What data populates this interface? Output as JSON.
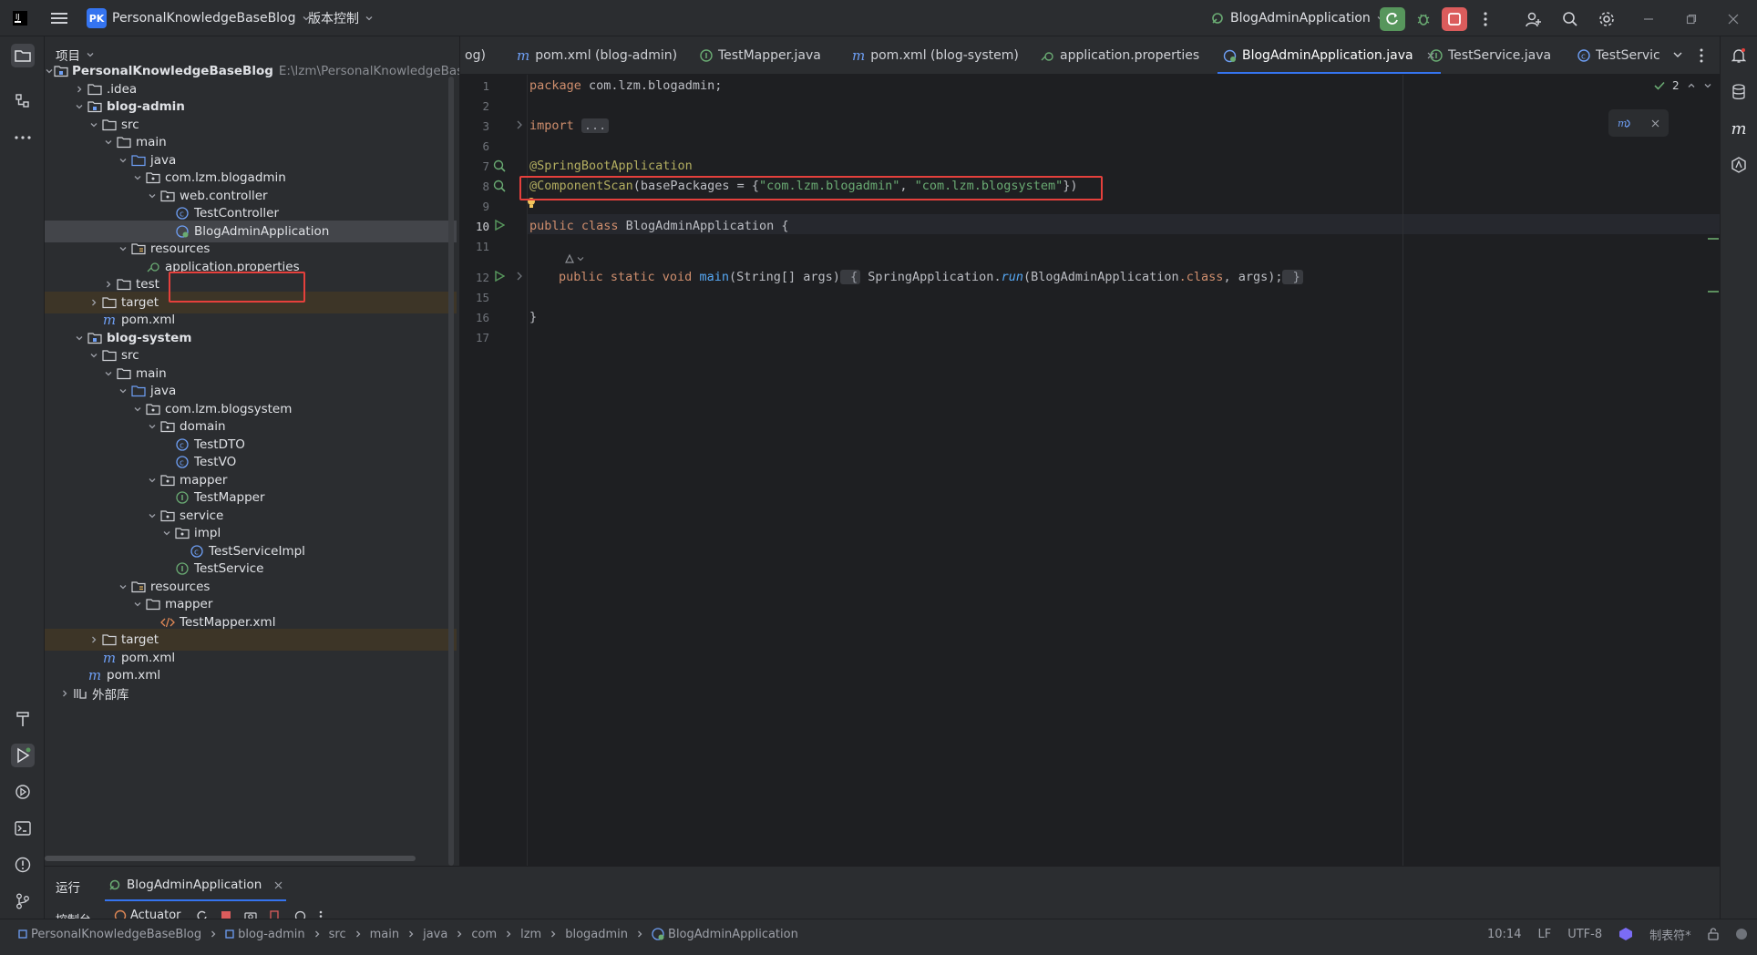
{
  "titlebar": {
    "project_badge": "PK",
    "project_name": "PersonalKnowledgeBaseBlog",
    "vcs_menu": "版本控制",
    "run_config": "BlogAdminApplication"
  },
  "project_panel": {
    "header": "项目",
    "root_name": "PersonalKnowledgeBaseBlog",
    "root_path": "E:\\lzm\\PersonalKnowledgeBaseBlog",
    "items": [
      {
        "label": ".idea"
      },
      {
        "label": "blog-admin"
      },
      {
        "label": "src"
      },
      {
        "label": "main"
      },
      {
        "label": "java"
      },
      {
        "label": "com.lzm.blogadmin"
      },
      {
        "label": "web.controller"
      },
      {
        "label": "TestController"
      },
      {
        "label": "BlogAdminApplication"
      },
      {
        "label": "resources"
      },
      {
        "label": "application.properties"
      },
      {
        "label": "test"
      },
      {
        "label": "target"
      },
      {
        "label": "pom.xml"
      },
      {
        "label": "blog-system"
      },
      {
        "label": "src"
      },
      {
        "label": "main"
      },
      {
        "label": "java"
      },
      {
        "label": "com.lzm.blogsystem"
      },
      {
        "label": "domain"
      },
      {
        "label": "TestDTO"
      },
      {
        "label": "TestVO"
      },
      {
        "label": "mapper"
      },
      {
        "label": "TestMapper"
      },
      {
        "label": "service"
      },
      {
        "label": "impl"
      },
      {
        "label": "TestServiceImpl"
      },
      {
        "label": "TestService"
      },
      {
        "label": "resources"
      },
      {
        "label": "mapper"
      },
      {
        "label": "TestMapper.xml"
      },
      {
        "label": "target"
      },
      {
        "label": "pom.xml"
      },
      {
        "label": "pom.xml"
      },
      {
        "label": "外部库"
      }
    ]
  },
  "tabs": [
    {
      "label": "og)"
    },
    {
      "label": "pom.xml (blog-admin)"
    },
    {
      "label": "TestMapper.java"
    },
    {
      "label": "pom.xml (blog-system)"
    },
    {
      "label": "application.properties"
    },
    {
      "label": "BlogAdminApplication.java"
    },
    {
      "label": "TestService.java"
    },
    {
      "label": "TestServic"
    }
  ],
  "editor": {
    "line_numbers": [
      "1",
      "2",
      "3",
      "6",
      "7",
      "8",
      "9",
      "10",
      "11",
      "12",
      "15",
      "16",
      "17"
    ],
    "l1_kw": "package",
    "l1_rest": " com.lzm.blogadmin;",
    "l3_kw": "import",
    "l3_fold": "...",
    "l7_ann": "@SpringBootApplication",
    "l8_ann": "@ComponentScan",
    "l8_mid": "(basePackages = {",
    "l8_str1": "\"com.lzm.blogadmin\"",
    "l8_comma": ", ",
    "l8_str2": "\"com.lzm.blogsystem\"",
    "l8_end": "})",
    "l10_kw": "public class",
    "l10_cls": " BlogAdminApplication",
    "l10_end": " {",
    "l12_kw": "public static void",
    "l12_fn": " main",
    "l12_args": "(String[] args)",
    "l12_open": " {",
    "l12_body1": " SpringApplication.",
    "l12_run": "run",
    "l12_body2": "(BlogAdminApplication",
    "l12_class": ".class",
    "l12_body3": ", args);",
    "l12_close": " }",
    "l16_brace": "}",
    "inspection_count": "2"
  },
  "bottom_panel": {
    "tab_run": "运行",
    "tab_app": "BlogAdminApplication",
    "sub_console": "控制台",
    "sub_actuator": "Actuator"
  },
  "statusbar": {
    "breadcrumbs": [
      "PersonalKnowledgeBaseBlog",
      "blog-admin",
      "src",
      "main",
      "java",
      "com",
      "lzm",
      "blogadmin",
      "BlogAdminApplication"
    ],
    "position": "10:14",
    "line_sep": "LF",
    "encoding": "UTF-8",
    "indent": "制表符*"
  },
  "colors": {
    "accent": "#3574f0",
    "highlight_box": "#e5403c",
    "run_green": "#57965c",
    "stop_red": "#db5c5c"
  }
}
